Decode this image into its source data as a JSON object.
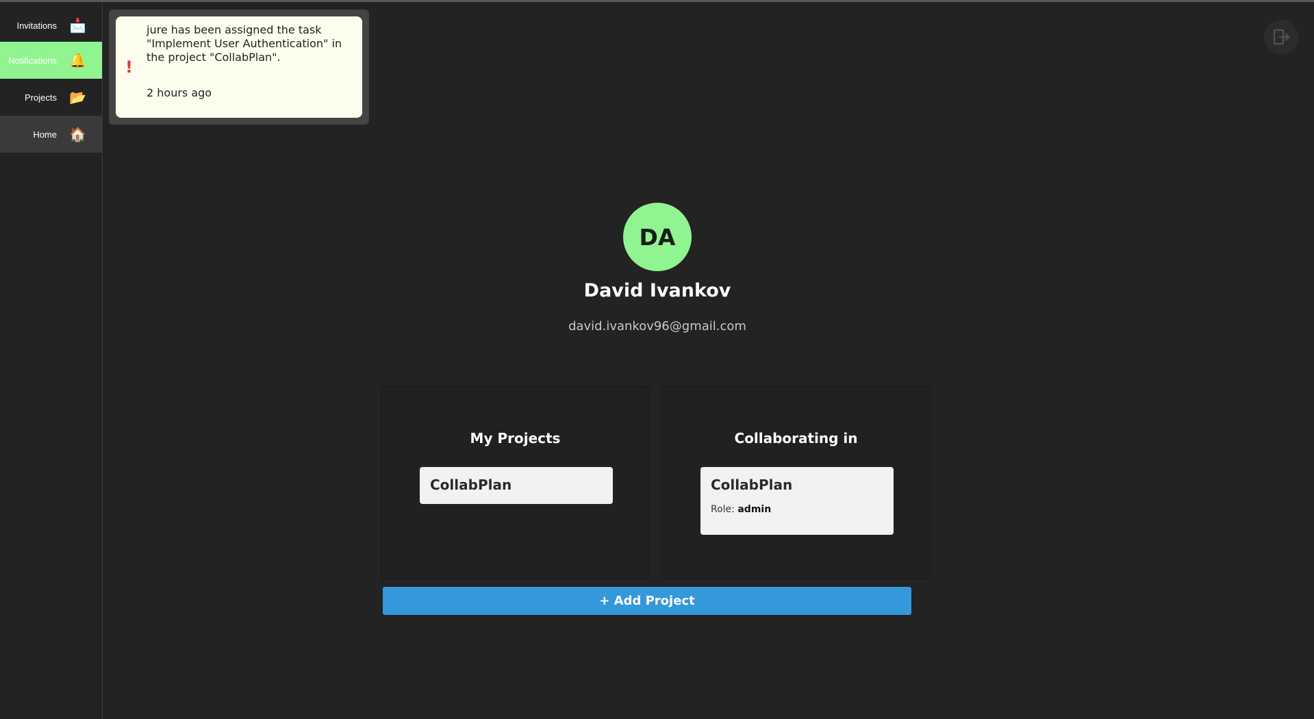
{
  "sidebar": {
    "items": [
      {
        "label": "Invitations",
        "icon": "inbox-tray-icon",
        "glyph": "📩"
      },
      {
        "label": "Notifications",
        "icon": "bell-icon",
        "glyph": "🔔"
      },
      {
        "label": "Projects",
        "icon": "open-folder-icon",
        "glyph": "📂"
      },
      {
        "label": "Home",
        "icon": "house-icon",
        "glyph": "🏠"
      }
    ],
    "active": "Notifications"
  },
  "notification": {
    "icon": "exclamation-icon",
    "mark": "!",
    "message": "jure has been assigned the task \"Implement User Authentication\" in the project \"CollabPlan\".",
    "time": "2 hours ago"
  },
  "header": {
    "logout_icon": "logout-icon"
  },
  "profile": {
    "initials": "DA",
    "name": "David Ivankov",
    "email": "david.ivankov96@gmail.com"
  },
  "my_projects": {
    "title": "My Projects",
    "items": [
      {
        "name": "CollabPlan"
      }
    ]
  },
  "collaborating": {
    "title": "Collaborating in",
    "items": [
      {
        "name": "CollabPlan",
        "role_label": "Role:",
        "role": "admin"
      }
    ]
  },
  "actions": {
    "add_project_label": "+ Add Project"
  },
  "colors": {
    "accent_green": "#90f490",
    "primary_blue": "#3498db",
    "background": "#232323",
    "alert_red": "#e03a3a"
  }
}
